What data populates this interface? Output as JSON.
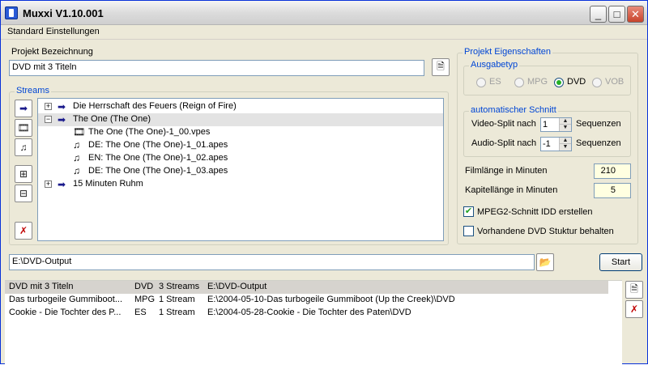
{
  "window": {
    "title": "Muxxi V1.10.001",
    "controls": {
      "minimize": "_",
      "maximize": "□",
      "close": "✕"
    }
  },
  "menu": {
    "items": [
      "Standard Einstellungen"
    ]
  },
  "project": {
    "label": "Projekt Bezeichnung",
    "value": "DVD mit 3 Titeln"
  },
  "streams": {
    "group_title": "Streams",
    "tree": [
      {
        "label": "Die Herrschaft des Feuers (Reign of Fire)",
        "expander": "+",
        "icon": "arrow-icon"
      },
      {
        "label": "The One (The One)",
        "expander": "−",
        "icon": "arrow-icon",
        "selected": true
      },
      {
        "label": "The One (The One)-1_00.vpes",
        "icon": "film-icon"
      },
      {
        "label": "DE: The One (The One)-1_01.apes",
        "icon": "music-note-icon"
      },
      {
        "label": "EN: The One (The One)-1_02.apes",
        "icon": "music-note-icon"
      },
      {
        "label": "DE: The One (The One)-1_03.apes",
        "icon": "music-note-icon"
      },
      {
        "label": "15 Minuten Ruhm",
        "expander": "+",
        "icon": "arrow-icon"
      }
    ]
  },
  "properties": {
    "group_title": "Projekt Eigenschaften",
    "output_type": {
      "title": "Ausgabetyp",
      "options": [
        "ES",
        "MPG",
        "DVD",
        "VOB"
      ],
      "selected": "DVD"
    },
    "auto_cut": {
      "title": "automatischer Schnitt",
      "video_label": "Video-Split nach",
      "video_value": "1",
      "audio_label": "Audio-Split nach",
      "audio_value": "-1",
      "unit": "Sequenzen"
    },
    "film_length_label": "Filmlänge in Minuten",
    "film_length_value": "210",
    "chapter_length_label": "Kapitellänge in Minuten",
    "chapter_length_value": "5",
    "checkbox_mpeg2": {
      "label": "MPEG2-Schnitt IDD erstellen",
      "checked": true
    },
    "checkbox_dvd": {
      "label": "Vorhandene DVD Stuktur behalten",
      "checked": false
    }
  },
  "output": {
    "path": "E:\\DVD-Output",
    "start_label": "Start"
  },
  "queue": {
    "rows": [
      {
        "name": "DVD mit 3 Titeln",
        "type": "DVD",
        "streams": "3 Streams",
        "path": "E:\\DVD-Output",
        "highlight": true
      },
      {
        "name": "Das turbogeile Gummiboot...",
        "type": "MPG",
        "streams": "1 Stream",
        "path": "E:\\2004-05-10-Das turbogeile Gummiboot (Up the Creek)\\DVD"
      },
      {
        "name": "Cookie - Die Tochter des P...",
        "type": "ES",
        "streams": "1 Stream",
        "path": "E:\\2004-05-28-Cookie - Die Tochter des Paten\\DVD"
      }
    ]
  }
}
